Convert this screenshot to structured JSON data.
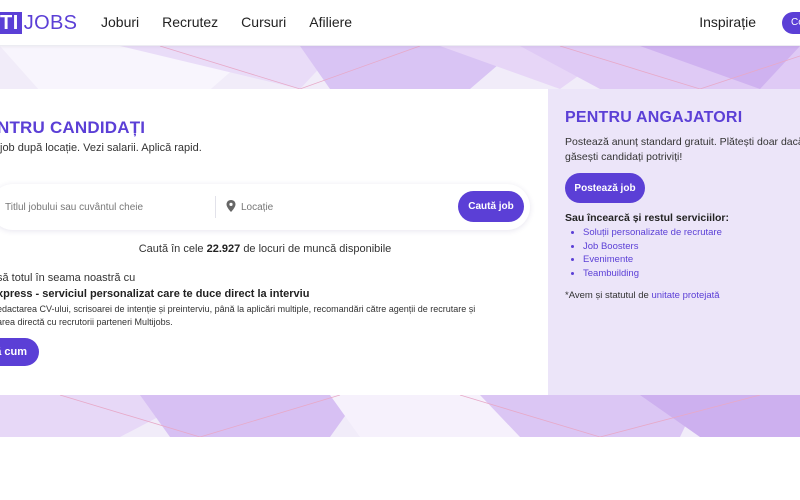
{
  "header": {
    "logo_mark": "TI",
    "logo_text": "JOBS",
    "nav": [
      "Joburi",
      "Recrutez",
      "Cursuri",
      "Afiliere"
    ],
    "right_link": "Inspirație",
    "cta_label": "Co"
  },
  "candidates": {
    "title": "NTRU CANDIDAȚI",
    "subtitle": "job după locație. Vezi salarii. Aplică rapid.",
    "search": {
      "keyword_placeholder": "Titlul jobului sau cuvântul cheie",
      "location_placeholder": "Locație",
      "button_label": "Caută job"
    },
    "count_prefix": "Caută în cele",
    "count_value": "22.927",
    "count_suffix": "de locuri de muncă disponibile",
    "promo_lead": "să totul în seama noastră cu",
    "promo_head": "xpress - serviciul personalizat care te duce direct la interviu",
    "promo_line1": "edactarea CV-ului, scrisoarei de intenție și preinterviu, până la aplicări multiple, recomandări către agenții de recrutare și",
    "promo_line2": "area directă cu recrutorii parteneri Multijobs.",
    "promo_button": "ă cum"
  },
  "employers": {
    "title": "PENTRU ANGAJATORI",
    "subtitle": "Postează anunț standard gratuit. Plătești doar dacă găsești candidați potriviți!",
    "button_label": "Postează job",
    "try_label": "Sau încearcă și restul serviciilor:",
    "services": [
      "Soluții personalizate de recrutare",
      "Job Boosters",
      "Evenimente",
      "Teambuilding"
    ],
    "note_prefix": "*Avem și statutul de",
    "note_link": "unitate protejată"
  },
  "colors": {
    "accent": "#5b3fd6",
    "employer_bg": "#ece5f9",
    "band_bg": "#f1ecf9"
  }
}
